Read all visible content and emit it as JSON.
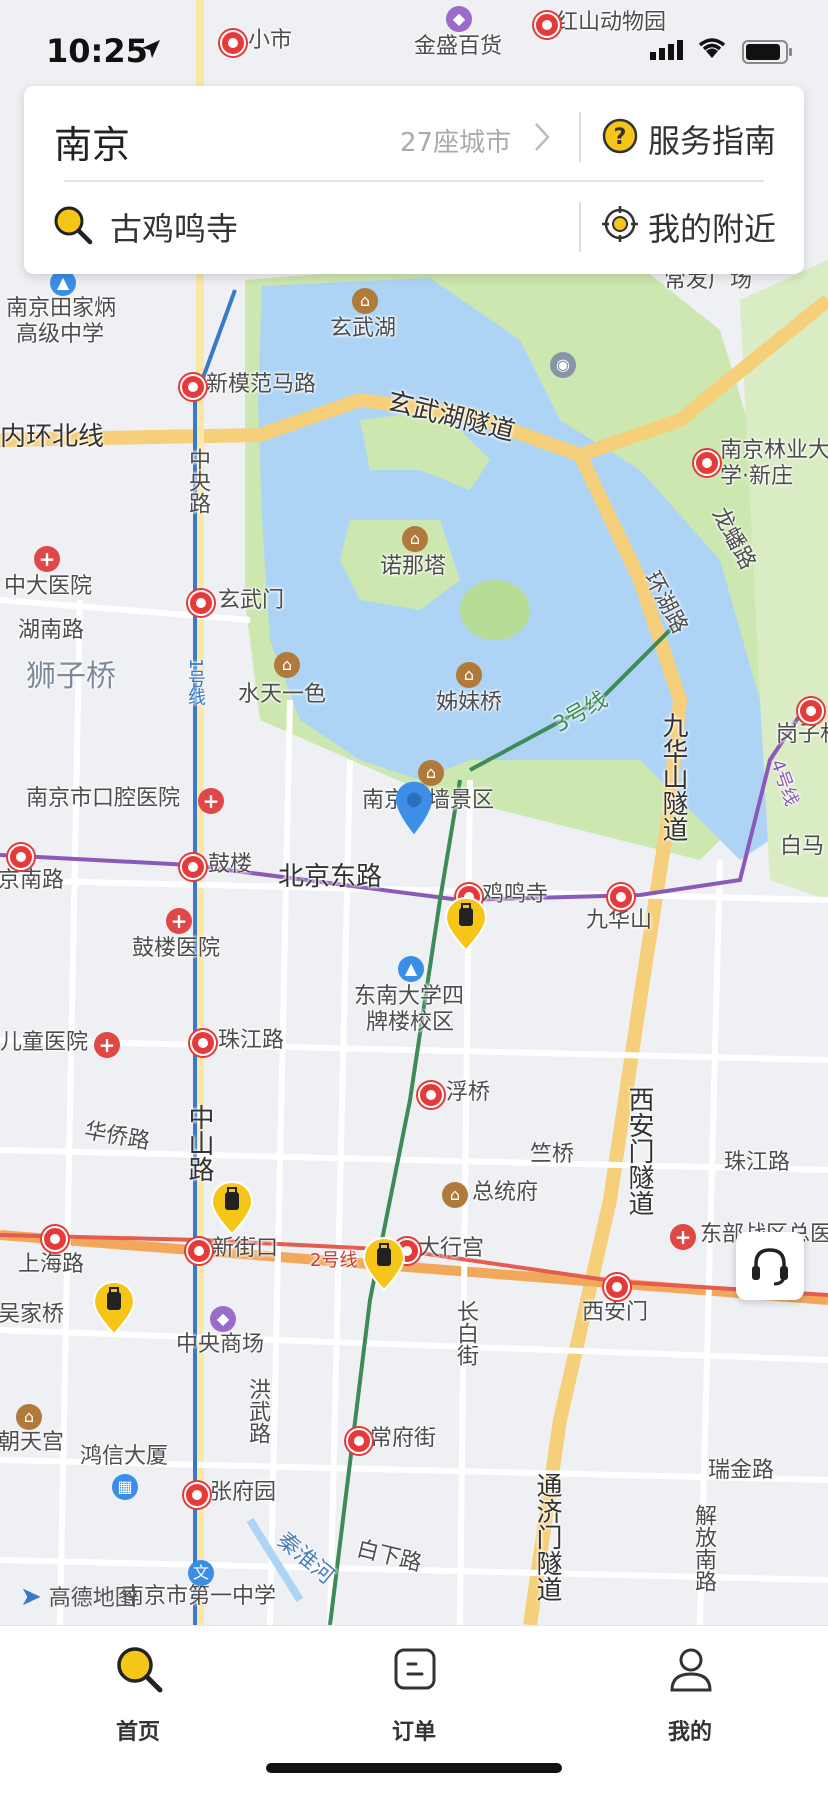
{
  "status_bar": {
    "time": "10:25"
  },
  "search_card": {
    "city": "南京",
    "city_count": "27座城市",
    "guide_label": "服务指南",
    "query": "古鸡鸣寺",
    "nearby_label": "我的附近"
  },
  "map": {
    "labels": {
      "xiaoshi": "小市",
      "jinsheng": "金盛百货",
      "hongshan": "红山动物园",
      "tianjiabing": "南京田家炳",
      "tianjiabing2": "高级中学",
      "xuanwuhu": "玄武湖",
      "xinmofan": "新模范马路",
      "neihuan": "内环北线",
      "tunnel": "玄武湖隧道",
      "linye": "南京林业大",
      "linye2": "学·新庄",
      "longpan": "龙蟠路",
      "zhongyang": "中央路",
      "nuonata": "诺那塔",
      "zhongda": "中大医院",
      "xuanwumen": "玄武门",
      "hunan": "湖南路",
      "shizi": "狮子桥",
      "huanhu": "环湖路",
      "shuitian": "水天一色",
      "zimei": "姊妹桥",
      "line3": "3号线",
      "line1": "1号线",
      "line4": "4号线",
      "gangzi": "岗子村",
      "baima": "白马",
      "jiuhuashan_tunnel": "九华山隧道",
      "kouqiang": "南京市口腔医院",
      "chengqiang": "南京城墙景区",
      "gulou": "鼓楼",
      "beijingdong": "北京东路",
      "jimingsi": "鸡鸣寺",
      "jiuhuashan": "九华山",
      "gulou_hosp": "鼓楼医院",
      "dongnan": "东南大学四",
      "dongnan2": "牌楼校区",
      "ertong": "儿童医院",
      "zhujiang": "珠江路",
      "fuqiao": "浮桥",
      "huaqiao": "华侨路",
      "zhongshan": "中山路",
      "xianmen": "西安门隧道",
      "zhuqiao": "竺桥",
      "zhujiang2": "珠江路",
      "zongtongfu": "总统府",
      "xinjiekou": "新街口",
      "line2": "2号线",
      "daxinggong": "大行宫",
      "dongbu": "东部战区总医",
      "shanghai": "上海路",
      "changbai": "长白街",
      "xianmen_st": "西安门",
      "wujia": "吴家桥",
      "zhongyangshang": "中央商场",
      "hongwu": "洪武路",
      "chaotian": "朝天宫",
      "changfu": "常府街",
      "hongxin": "鸿信大厦",
      "ruijin": "瑞金路",
      "zhangfu": "张府园",
      "tongji": "通济门隧道",
      "jiefang": "解放南路",
      "baixia": "白下路",
      "qinhuai": "秦淮河",
      "yizhong": "南京市第一中学",
      "changfa": "常发广场",
      "jianan": "京南路"
    },
    "logo": "高德地图"
  },
  "tabs": [
    {
      "label": "首页",
      "icon": "search-icon",
      "active": true
    },
    {
      "label": "订单",
      "icon": "order-icon",
      "active": false
    },
    {
      "label": "我的",
      "icon": "user-icon",
      "active": false
    }
  ],
  "colors": {
    "accent": "#f5c518",
    "water": "#aed4f5",
    "park": "#cde7b0",
    "metro_red": "#e63a3a"
  }
}
